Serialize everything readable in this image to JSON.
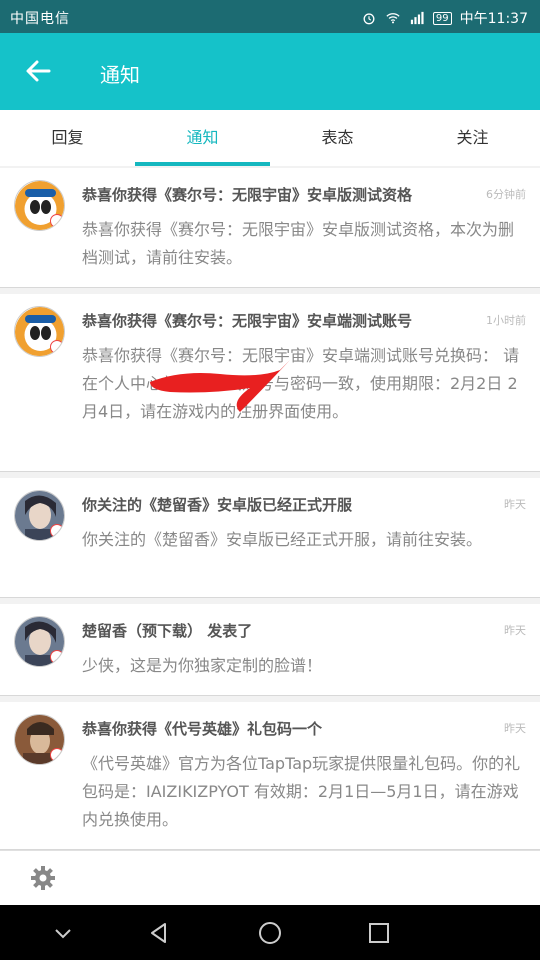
{
  "status_bar": {
    "carrier": "中国电信",
    "battery": "99",
    "time": "中午11:37"
  },
  "app_bar": {
    "title": "通知"
  },
  "tabs": [
    {
      "label": "回复",
      "active": false
    },
    {
      "label": "通知",
      "active": true
    },
    {
      "label": "表态",
      "active": false
    },
    {
      "label": "关注",
      "active": false
    }
  ],
  "notifications": [
    {
      "title": "恭喜你获得《赛尔号：无限宇宙》安卓版测试资格",
      "time": "6分钟前",
      "body": "恭喜你获得《赛尔号：无限宇宙》安卓版测试资格，本次为删档测试，请前往安装。",
      "avatar": "seer-avatar"
    },
    {
      "title": "恭喜你获得《赛尔号：无限宇宙》安卓端测试账号",
      "time": "1小时前",
      "body": "恭喜你获得《赛尔号：无限宇宙》安卓端测试账号兑换码：                请在个人中心兑换。测试账号与密码一致，使用期限：2月2日 2月4日，请在游戏内的注册界面使用。",
      "avatar": "seer-avatar"
    },
    {
      "title": "你关注的《楚留香》安卓版已经正式开服",
      "time": "昨天",
      "body": "你关注的《楚留香》安卓版已经正式开服，请前往安装。",
      "avatar": "chuliuxiang-avatar"
    },
    {
      "title": "楚留香（预下载） 发表了",
      "time": "昨天",
      "body": "少侠，这是为你独家定制的脸谱！",
      "avatar": "chuliuxiang-avatar"
    },
    {
      "title": "恭喜你获得《代号英雄》礼包码一个",
      "time": "昨天",
      "body": "《代号英雄》官方为各位TapTap玩家提供限量礼包码。你的礼包码是：IAIZIKIZPYOT 有效期：2月1日—5月1日，请在游戏内兑换使用。",
      "avatar": "codename-hero-avatar"
    }
  ],
  "colors": {
    "accent": "#15c2c9",
    "status_bar": "#1c6b72",
    "tab_active": "#15b7bf"
  }
}
